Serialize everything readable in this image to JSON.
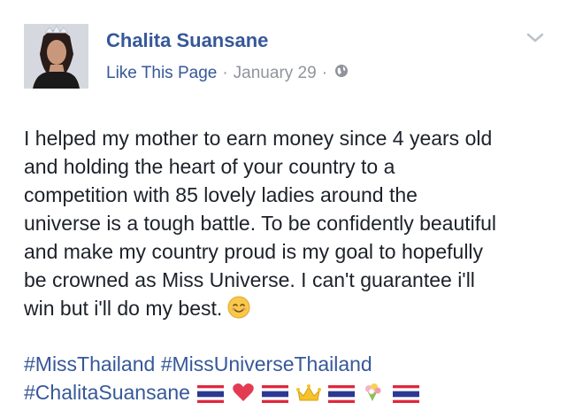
{
  "post": {
    "author": "Chalita Suansane",
    "like_label": "Like This Page",
    "separator": "·",
    "date": "January 29",
    "privacy_icon": "globe-icon",
    "menu_icon": "chevron-down-icon",
    "body_lines": [
      "I helped my mother to earn money since 4 years old",
      "and holding the heart of your country to a",
      "competition with 85 lovely ladies around the",
      "universe is a tough battle. To be confidently beautiful",
      "and make my country proud is my goal to hopefully",
      "be crowned as Miss Universe. I can't guarantee i'll",
      "win but i'll do my best."
    ],
    "smile_emoji": "smiling-face-emoji",
    "hashtags_line1": [
      "#MissThailand",
      "#MissUniverseThailand"
    ],
    "hashtags_line2": "#ChalitaSuansane",
    "emoji_sequence": [
      "thai-flag",
      "red-heart",
      "thai-flag",
      "crown",
      "thai-flag",
      "bouquet",
      "thai-flag"
    ]
  },
  "colors": {
    "link": "#365899",
    "text": "#1d2129",
    "meta": "#90949c",
    "thai_red": "#e0283c",
    "thai_blue": "#2b3990"
  }
}
